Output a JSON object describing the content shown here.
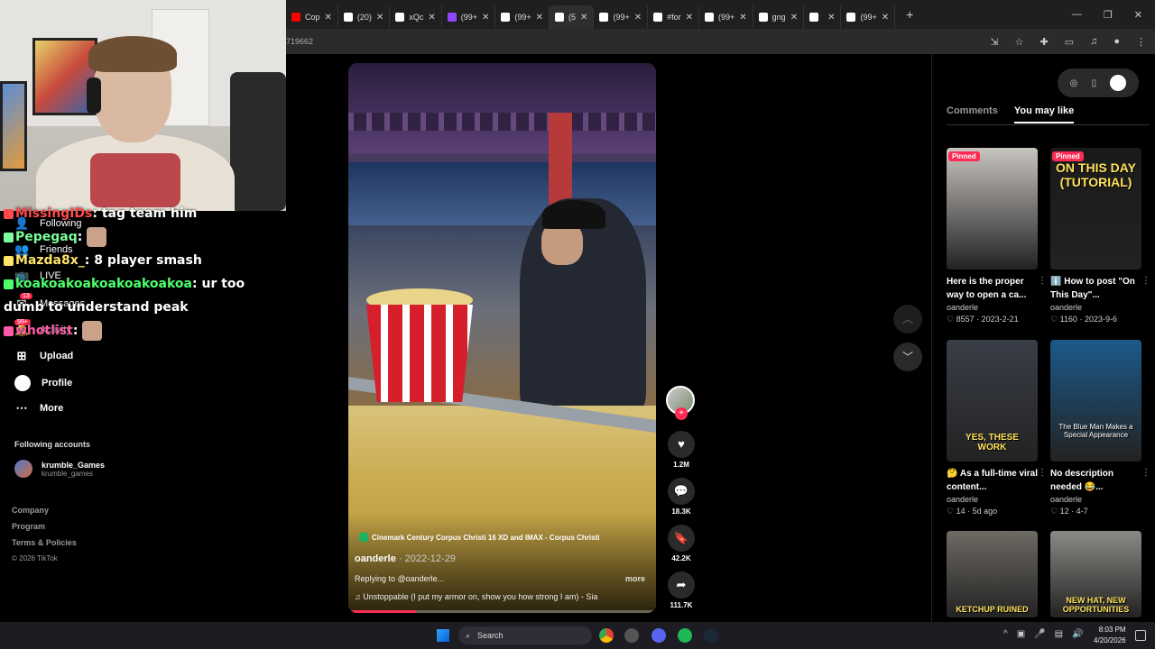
{
  "browser": {
    "tabs": [
      {
        "label": "Cop",
        "icon": "youtube-icon",
        "color": "#ff0000"
      },
      {
        "label": "(20)",
        "icon": "x-icon",
        "color": "#ffffff"
      },
      {
        "label": "xQc",
        "icon": "tiktok-icon",
        "color": "#ffffff"
      },
      {
        "label": "(99+",
        "icon": "twitch-icon",
        "color": "#9146ff"
      },
      {
        "label": "(99+",
        "icon": "tiktok-icon",
        "color": "#ffffff"
      },
      {
        "label": "(5",
        "icon": "tiktok-icon",
        "color": "#ffffff",
        "active": true
      },
      {
        "label": "(99+",
        "icon": "tiktok-icon",
        "color": "#ffffff"
      },
      {
        "label": "#for",
        "icon": "tiktok-icon",
        "color": "#ffffff"
      },
      {
        "label": "(99+",
        "icon": "tiktok-icon",
        "color": "#ffffff"
      },
      {
        "label": "gng",
        "icon": "tiktok-icon",
        "color": "#ffffff"
      },
      {
        "label": "",
        "icon": "tiktok-icon",
        "color": "#ffffff"
      },
      {
        "label": "(99+",
        "icon": "tiktok-icon",
        "color": "#ffffff"
      }
    ],
    "new_tab": "+",
    "url": "719662"
  },
  "chat": [
    {
      "user": "MissingIDs",
      "text": "tag team him",
      "color": "#ff4a4a"
    },
    {
      "user": "Pepegaq",
      "text": "",
      "color": "#7cff9a"
    },
    {
      "user": "Mazda8x_",
      "text": "8 player smash",
      "color": "#ffe36a"
    },
    {
      "user": "koakoakoakoakoakoakoa",
      "text": "ur too dumb to understand peak",
      "color": "#4cff6a"
    },
    {
      "user": "whotlist",
      "text": "",
      "color": "#ff5aa8"
    }
  ],
  "sidebar": {
    "following": "Following",
    "friends": "Friends",
    "live": "LIVE",
    "messages": "Messages",
    "messages_badge": "13",
    "activity": "Activity",
    "activity_badge": "99+",
    "upload": "Upload",
    "profile": "Profile",
    "more": "More",
    "following_accounts": "Following accounts",
    "account_name": "krumble_Games",
    "account_handle": "krumble_games",
    "footer": [
      "Company",
      "Program",
      "Terms & Policies"
    ],
    "copyright": "© 2026 TikTok"
  },
  "video": {
    "location": "Cinemark Century Corpus Christi 16 XD and IMAX - Corpus Christi",
    "author": "oanderle",
    "date": "2022-12-29",
    "reply": "Replying to @oanderle...",
    "more": "more",
    "sound": "Unstoppable (I put my armor on, show you how strong I am) - Sia",
    "progress": 0.22,
    "likes": "1.2M",
    "comments": "18.3K",
    "saves": "42.2K",
    "shares": "111.7K"
  },
  "panel": {
    "tab_comments": "Comments",
    "tab_you_may_like": "You may like",
    "cards": [
      {
        "pinned": "Pinned",
        "thumb_text": "",
        "title": "Here is the proper way to open a ca...",
        "author": "oanderle",
        "views": "8557",
        "date": "2023-2-21",
        "bg": "#c8c4c0"
      },
      {
        "pinned": "Pinned",
        "thumb_text": "ON THIS DAY (TUTORIAL)",
        "title": "ℹ️ How to post \"On This Day\"...",
        "author": "oanderle",
        "views": "1160",
        "date": "2023-9-6",
        "bg": "#1a1a1a"
      },
      {
        "pinned": "",
        "thumb_text": "YES, THESE WORK",
        "title": "🤔 As a full-time viral content...",
        "author": "oanderle",
        "views": "14",
        "date": "5d ago",
        "bg": "#3a3e48"
      },
      {
        "pinned": "",
        "thumb_text": "The Blue Man Makes a Special Appearance",
        "title": "No description needed 😂...",
        "author": "oanderle",
        "views": "12",
        "date": "4-7",
        "bg": "#1c5a8a"
      },
      {
        "pinned": "",
        "thumb_text": "KETCHUP RUINED",
        "title": "",
        "author": "",
        "views": "",
        "date": "",
        "bg": "#6e6a64"
      },
      {
        "pinned": "",
        "thumb_text": "NEW HAT, NEW OPPORTUNITIES",
        "title": "",
        "author": "",
        "views": "",
        "date": "",
        "bg": "#8a8a86"
      }
    ]
  },
  "taskbar": {
    "search": "Search",
    "time": "8:03 PM",
    "date": "4/20/2026"
  }
}
